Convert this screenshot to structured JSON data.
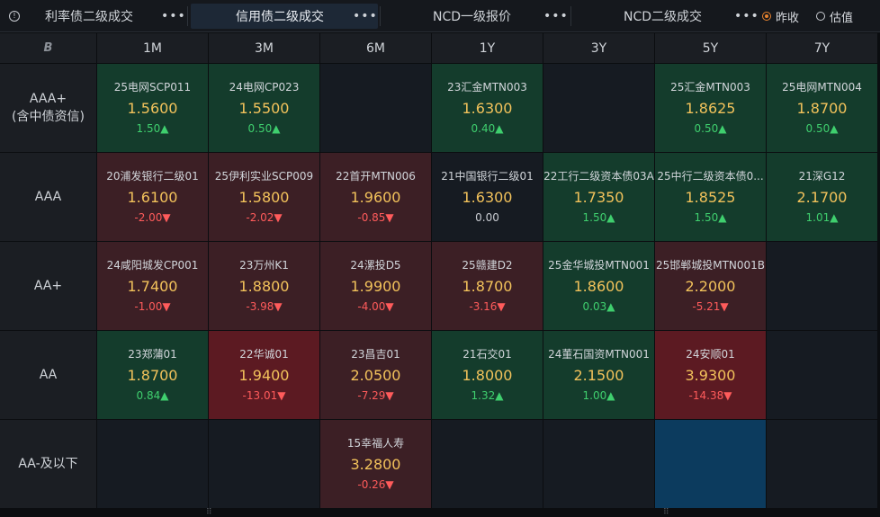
{
  "tabs": [
    {
      "label": "利率债二级成交",
      "active": false
    },
    {
      "label": "信用债二级成交",
      "active": true
    },
    {
      "label": "NCD一级报价",
      "active": false
    },
    {
      "label": "NCD二级成交",
      "active": false
    }
  ],
  "more_glyph": "•••",
  "radio": {
    "prev_close": "昨收",
    "valuation": "估值",
    "selected": "prev_close"
  },
  "corner_glyph": "B",
  "columns": [
    "1M",
    "3M",
    "6M",
    "1Y",
    "3Y",
    "5Y",
    "7Y"
  ],
  "rows": [
    {
      "label": "AAA+\n(含中债资信)",
      "cells": [
        {
          "name": "25电网SCP011",
          "price": "1.5600",
          "change": "1.50▲",
          "dir": "up",
          "bg": "green"
        },
        {
          "name": "24电网CP023",
          "price": "1.5500",
          "change": "0.50▲",
          "dir": "up",
          "bg": "green"
        },
        {
          "name": "",
          "price": "",
          "change": "",
          "dir": "",
          "bg": "dark"
        },
        {
          "name": "23汇金MTN003",
          "price": "1.6300",
          "change": "0.40▲",
          "dir": "up",
          "bg": "green"
        },
        {
          "name": "",
          "price": "",
          "change": "",
          "dir": "",
          "bg": "dark"
        },
        {
          "name": "25汇金MTN003",
          "price": "1.8625",
          "change": "0.50▲",
          "dir": "up",
          "bg": "green"
        },
        {
          "name": "25电网MTN004",
          "price": "1.8700",
          "change": "0.50▲",
          "dir": "up",
          "bg": "green"
        }
      ]
    },
    {
      "label": "AAA",
      "cells": [
        {
          "name": "20浦发银行二级01",
          "price": "1.6100",
          "change": "-2.00▼",
          "dir": "down",
          "bg": "red"
        },
        {
          "name": "25伊利实业SCP009",
          "price": "1.5800",
          "change": "-2.02▼",
          "dir": "down",
          "bg": "red"
        },
        {
          "name": "22首开MTN006",
          "price": "1.9600",
          "change": "-0.85▼",
          "dir": "down",
          "bg": "red"
        },
        {
          "name": "21中国银行二级01",
          "price": "1.6300",
          "change": "0.00",
          "dir": "flat",
          "bg": "dark"
        },
        {
          "name": "22工行二级资本债03A",
          "price": "1.7350",
          "change": "1.50▲",
          "dir": "up",
          "bg": "green"
        },
        {
          "name": "25中行二级资本债0...",
          "price": "1.8525",
          "change": "1.50▲",
          "dir": "up",
          "bg": "green"
        },
        {
          "name": "21深G12",
          "price": "2.1700",
          "change": "1.01▲",
          "dir": "up",
          "bg": "green"
        }
      ]
    },
    {
      "label": "AA+",
      "cells": [
        {
          "name": "24咸阳城发CP001",
          "price": "1.7400",
          "change": "-1.00▼",
          "dir": "down",
          "bg": "red"
        },
        {
          "name": "23万州K1",
          "price": "1.8800",
          "change": "-3.98▼",
          "dir": "down",
          "bg": "red"
        },
        {
          "name": "24漯投D5",
          "price": "1.9900",
          "change": "-4.00▼",
          "dir": "down",
          "bg": "red"
        },
        {
          "name": "25赣建D2",
          "price": "1.8700",
          "change": "-3.16▼",
          "dir": "down",
          "bg": "red"
        },
        {
          "name": "25金华城投MTN001",
          "price": "1.8600",
          "change": "0.03▲",
          "dir": "up",
          "bg": "green"
        },
        {
          "name": "25邯郸城投MTN001B",
          "price": "2.2000",
          "change": "-5.21▼",
          "dir": "down",
          "bg": "red"
        },
        {
          "name": "",
          "price": "",
          "change": "",
          "dir": "",
          "bg": "dark"
        }
      ]
    },
    {
      "label": "AA",
      "cells": [
        {
          "name": "23郑蒲01",
          "price": "1.8700",
          "change": "0.84▲",
          "dir": "up",
          "bg": "green"
        },
        {
          "name": "22华诚01",
          "price": "1.9400",
          "change": "-13.01▼",
          "dir": "down",
          "bg": "darkred"
        },
        {
          "name": "23昌吉01",
          "price": "2.0500",
          "change": "-7.29▼",
          "dir": "down",
          "bg": "red"
        },
        {
          "name": "21石交01",
          "price": "1.8000",
          "change": "1.32▲",
          "dir": "up",
          "bg": "green"
        },
        {
          "name": "24董石国资MTN001",
          "price": "2.1500",
          "change": "1.00▲",
          "dir": "up",
          "bg": "green"
        },
        {
          "name": "24安顺01",
          "price": "3.9300",
          "change": "-14.38▼",
          "dir": "down",
          "bg": "darkred"
        },
        {
          "name": "",
          "price": "",
          "change": "",
          "dir": "",
          "bg": "dark"
        }
      ]
    },
    {
      "label": "AA-及以下",
      "cells": [
        {
          "name": "",
          "price": "",
          "change": "",
          "dir": "",
          "bg": "dark"
        },
        {
          "name": "",
          "price": "",
          "change": "",
          "dir": "",
          "bg": "dark"
        },
        {
          "name": "15幸福人寿",
          "price": "3.2800",
          "change": "-0.26▼",
          "dir": "down",
          "bg": "red"
        },
        {
          "name": "",
          "price": "",
          "change": "",
          "dir": "",
          "bg": "dark"
        },
        {
          "name": "",
          "price": "",
          "change": "",
          "dir": "",
          "bg": "dark"
        },
        {
          "name": "",
          "price": "",
          "change": "",
          "dir": "",
          "bg": "blue"
        },
        {
          "name": "",
          "price": "",
          "change": "",
          "dir": "",
          "bg": "dark"
        }
      ]
    }
  ]
}
